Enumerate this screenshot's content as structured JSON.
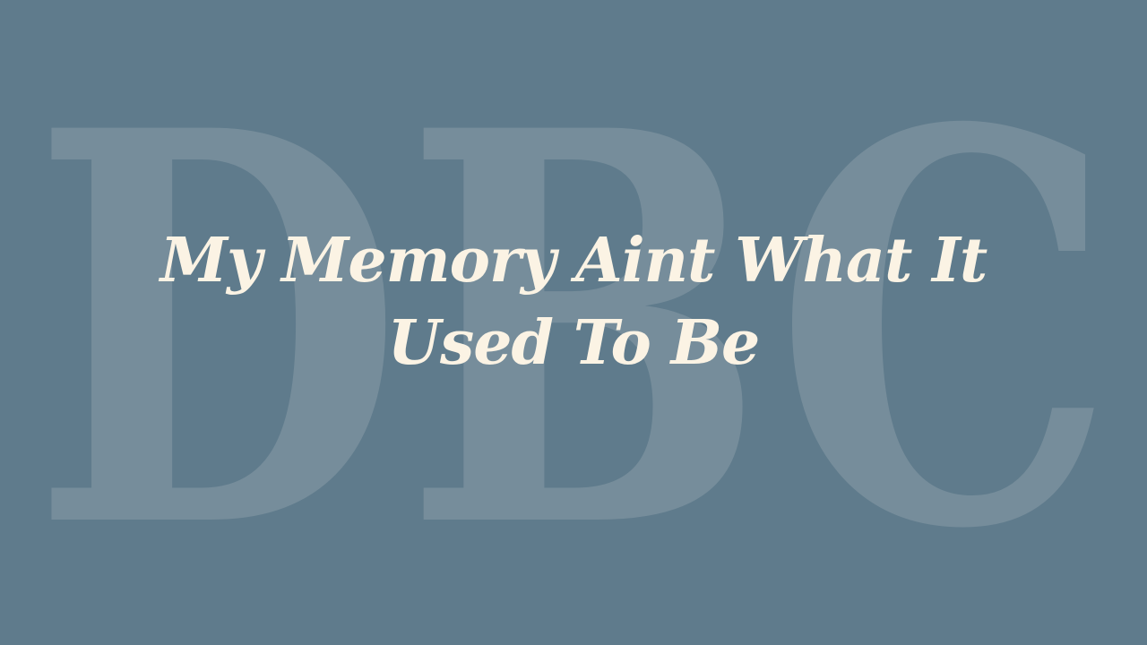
{
  "background": {
    "color": "#5f7b8c",
    "watermark_text": "DBC",
    "watermark_color": "#7a909d"
  },
  "title": {
    "text": "My Memory Aint What It Used To Be",
    "color": "#fbf3e4"
  }
}
